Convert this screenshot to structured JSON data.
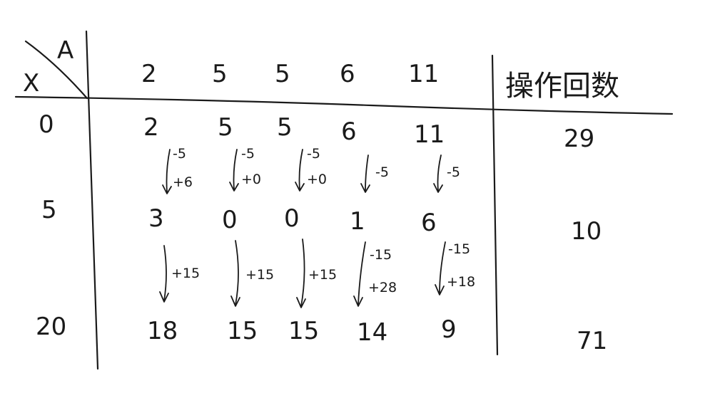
{
  "corner": {
    "row_var": "X",
    "col_var": "A"
  },
  "header": {
    "a_values": [
      "2",
      "5",
      "5",
      "6",
      "11"
    ],
    "ops_label": "操作回数"
  },
  "rows": [
    {
      "x": "0",
      "values": [
        "2",
        "5",
        "5",
        "6",
        "11"
      ],
      "ops": "29"
    },
    {
      "x": "5",
      "values": [
        "3",
        "0",
        "0",
        "1",
        "6"
      ],
      "ops": "10"
    },
    {
      "x": "20",
      "values": [
        "18",
        "15",
        "15",
        "14",
        "9"
      ],
      "ops": "71"
    }
  ],
  "transitions": [
    [
      {
        "line1": "-5",
        "line2": "+6"
      },
      {
        "line1": "-5",
        "line2": "+0"
      },
      {
        "line1": "-5",
        "line2": "+0"
      },
      {
        "line1": "-5",
        "line2": ""
      },
      {
        "line1": "-5",
        "line2": ""
      }
    ],
    [
      {
        "line1": "+15",
        "line2": ""
      },
      {
        "line1": "+15",
        "line2": ""
      },
      {
        "line1": "+15",
        "line2": ""
      },
      {
        "line1": "-15",
        "line2": "+28"
      },
      {
        "line1": "-15",
        "line2": "+18"
      }
    ]
  ]
}
